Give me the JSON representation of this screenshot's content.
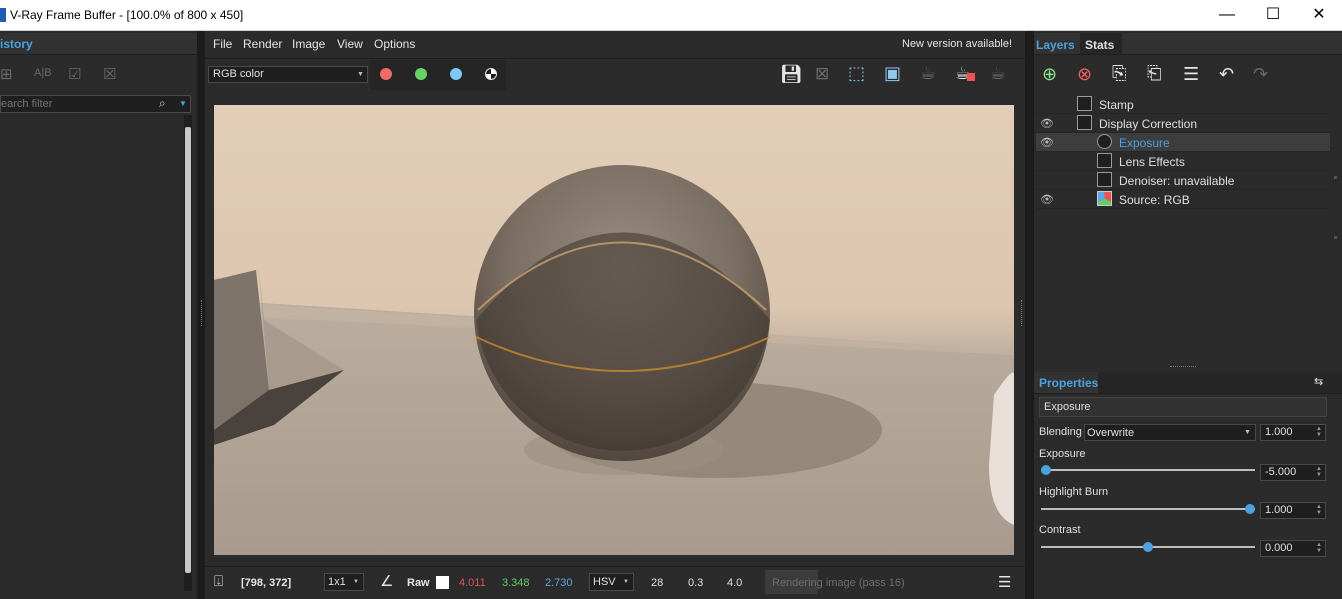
{
  "window": {
    "title": "V-Ray Frame Buffer - [100.0% of 800 x 450]",
    "controls": {
      "minimize": "—",
      "maximize": "☐",
      "close": "✕"
    }
  },
  "history": {
    "tab_label": "istory",
    "search_placeholder": "earch filter"
  },
  "menu": {
    "items": [
      "File",
      "Render",
      "Image",
      "View",
      "Options"
    ],
    "notice": "New version available!"
  },
  "toolbar": {
    "channel": "RGB color",
    "colors": {
      "red": "#f26a6a",
      "green": "#66d266",
      "blue": "#7ccaf5"
    }
  },
  "layers": {
    "tabs": [
      "Layers",
      "Stats"
    ],
    "rows": [
      {
        "label": "Stamp",
        "visible": false,
        "selected": false
      },
      {
        "label": "Display Correction",
        "visible": true,
        "selected": false
      },
      {
        "label": "Exposure",
        "visible": true,
        "selected": true
      },
      {
        "label": "Lens Effects",
        "visible": false,
        "selected": false
      },
      {
        "label": "Denoiser: unavailable",
        "visible": false,
        "selected": false
      },
      {
        "label": "Source: RGB",
        "visible": true,
        "selected": false
      }
    ]
  },
  "properties": {
    "title": "Properties",
    "layer_name": "Exposure",
    "blending": {
      "label": "Blending",
      "mode": "Overwrite",
      "value": "1.000"
    },
    "exposure": {
      "label": "Exposure",
      "value": "-5.000",
      "slider_fraction": 0.0
    },
    "highlight_burn": {
      "label": "Highlight Burn",
      "value": "1.000",
      "slider_fraction": 1.0
    },
    "contrast": {
      "label": "Contrast",
      "value": "0.000",
      "slider_fraction": 0.5
    }
  },
  "statusbar": {
    "coords": "[798, 372]",
    "zoom": "1x1",
    "mode": "Raw",
    "r": "4.011",
    "g": "3.348",
    "b": "2.730",
    "colorspace": "HSV",
    "h": "28",
    "s": "0.3",
    "v": "4.0",
    "progress": "Rendering image (pass 16)",
    "colors": {
      "r": "#e05555",
      "g": "#5ccf5c",
      "b": "#5aa9e6"
    }
  }
}
